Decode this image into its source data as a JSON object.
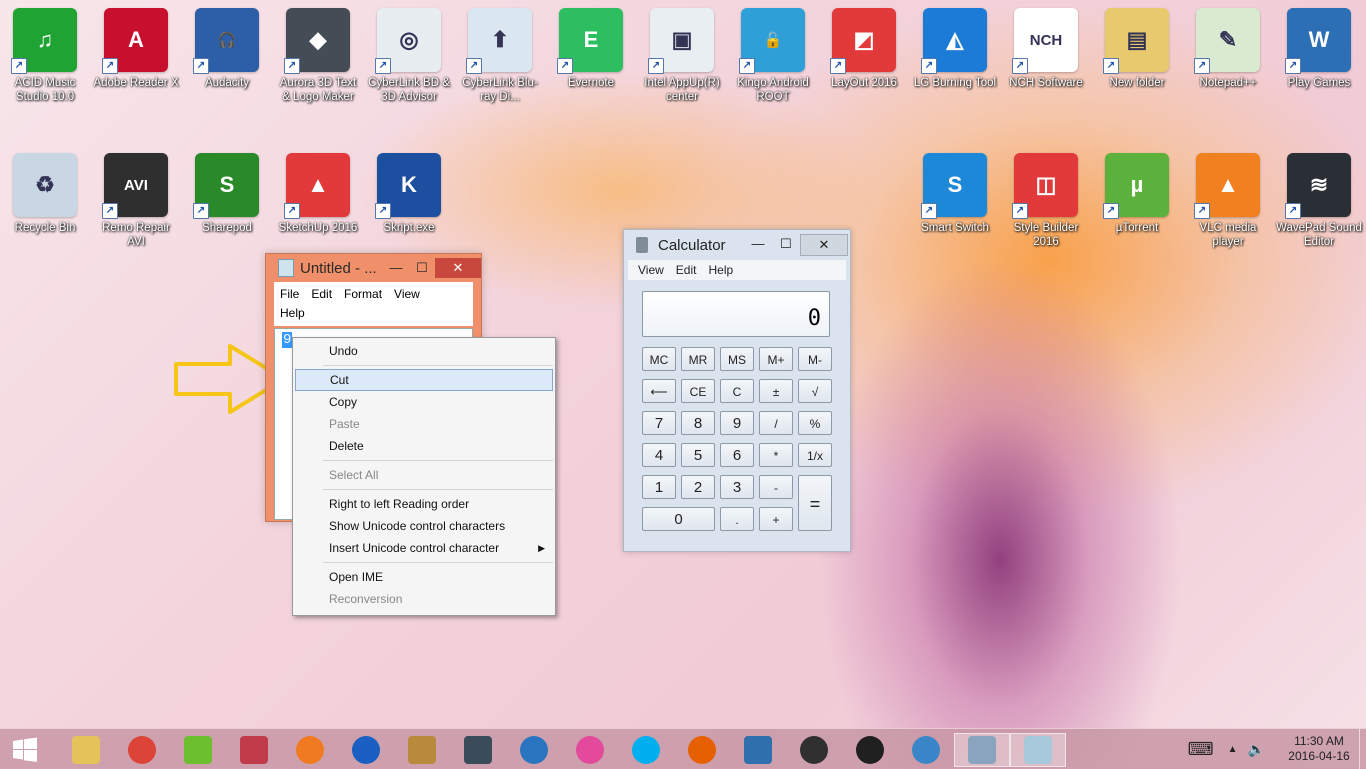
{
  "desktop": {
    "icons_row1": [
      {
        "label": "ACID Music Studio 10.0",
        "color": "#1fa333",
        "glyph": "♫"
      },
      {
        "label": "Adobe Reader X",
        "color": "#c8102e",
        "glyph": "A"
      },
      {
        "label": "Audacity",
        "color": "#2d5fa8",
        "glyph": "🎧"
      },
      {
        "label": "Aurora 3D Text & Logo Maker",
        "color": "#444c56",
        "glyph": "◆"
      },
      {
        "label": "CyberLink BD & 3D Advisor",
        "color": "#e8edf2",
        "glyph": "◎"
      },
      {
        "label": "CyberLink Blu-ray Di...",
        "color": "#dbe7f0",
        "glyph": "⬆"
      },
      {
        "label": "Evernote",
        "color": "#2dbe60",
        "glyph": "E"
      },
      {
        "label": "Intel AppUp(R) center",
        "color": "#e9eef3",
        "glyph": "▣"
      },
      {
        "label": "Kingo Android ROOT",
        "color": "#2f9fd8",
        "glyph": "🔓"
      },
      {
        "label": "LayOut 2016",
        "color": "#e23a3a",
        "glyph": "◩"
      },
      {
        "label": "LG Burning Tool",
        "color": "#1c7bd6",
        "glyph": "◭"
      },
      {
        "label": "NCH Software",
        "color": "#ffffff",
        "glyph": "NCH"
      },
      {
        "label": "New folder",
        "color": "#e9c96d",
        "glyph": "▤"
      },
      {
        "label": "Notepad++",
        "color": "#d9ead0",
        "glyph": "✎"
      },
      {
        "label": "Play Games",
        "color": "#2d6fb5",
        "glyph": "W"
      }
    ],
    "icons_row2_left": [
      {
        "label": "Recycle Bin",
        "color": "#c9d7e4",
        "glyph": "♻"
      },
      {
        "label": "Remo Repair AVI",
        "color": "#2f2f2f",
        "glyph": "AVI"
      },
      {
        "label": "Sharepod",
        "color": "#2a8a2a",
        "glyph": "S"
      },
      {
        "label": "SketchUp 2016",
        "color": "#e23a3a",
        "glyph": "▲"
      },
      {
        "label": "Skript.exe",
        "color": "#1d4fa0",
        "glyph": "K"
      }
    ],
    "icons_row2_right": [
      {
        "label": "Smart Switch",
        "color": "#1e88d8",
        "glyph": "S"
      },
      {
        "label": "Style Builder 2016",
        "color": "#e23a3a",
        "glyph": "◫"
      },
      {
        "label": "µTorrent",
        "color": "#5bb13b",
        "glyph": "µ"
      },
      {
        "label": "VLC media player",
        "color": "#f08020",
        "glyph": "▲"
      },
      {
        "label": "WavePad Sound Editor",
        "color": "#2a2f36",
        "glyph": "≋"
      }
    ]
  },
  "notepad": {
    "title": "Untitled - ...",
    "minimize": "—",
    "maximize": "☐",
    "close": "✕",
    "menu": [
      "File",
      "Edit",
      "Format",
      "View",
      "Help"
    ],
    "text": "9"
  },
  "context_menu": {
    "items": [
      {
        "label": "Undo",
        "state": "normal"
      },
      {
        "sep": true
      },
      {
        "label": "Cut",
        "state": "highlight"
      },
      {
        "label": "Copy",
        "state": "normal"
      },
      {
        "label": "Paste",
        "state": "disabled"
      },
      {
        "label": "Delete",
        "state": "normal"
      },
      {
        "sep": true
      },
      {
        "label": "Select All",
        "state": "disabled"
      },
      {
        "sep": true
      },
      {
        "label": "Right to left Reading order",
        "state": "normal"
      },
      {
        "label": "Show Unicode control characters",
        "state": "normal"
      },
      {
        "label": "Insert Unicode control character",
        "state": "normal",
        "submenu": true
      },
      {
        "sep": true
      },
      {
        "label": "Open IME",
        "state": "normal"
      },
      {
        "label": "Reconversion",
        "state": "disabled"
      }
    ]
  },
  "calculator": {
    "title": "Calculator",
    "minimize": "—",
    "maximize": "☐",
    "close": "✕",
    "menu": [
      "View",
      "Edit",
      "Help"
    ],
    "display": "0",
    "keys": [
      [
        "MC",
        "MR",
        "MS",
        "M+",
        "M-"
      ],
      [
        "⟵",
        "CE",
        "C",
        "±",
        "√"
      ],
      [
        "7",
        "8",
        "9",
        "/",
        "%"
      ],
      [
        "4",
        "5",
        "6",
        "*",
        "1/x"
      ],
      [
        "1",
        "2",
        "3",
        "-",
        "="
      ],
      [
        "0",
        ".",
        "+"
      ]
    ]
  },
  "taskbar": {
    "apps": [
      {
        "name": "file-explorer",
        "color": "#e6c25a"
      },
      {
        "name": "chrome",
        "color": "#db4437"
      },
      {
        "name": "wondershare",
        "color": "#6cbf2e"
      },
      {
        "name": "winrar",
        "color": "#c23b4b"
      },
      {
        "name": "video-player",
        "color": "#f07a20"
      },
      {
        "name": "malwarebytes",
        "color": "#1b5fc2"
      },
      {
        "name": "app-library",
        "color": "#b98a3c"
      },
      {
        "name": "video-editor",
        "color": "#3a4b5a"
      },
      {
        "name": "cyberlink",
        "color": "#2a75c0"
      },
      {
        "name": "itunes",
        "color": "#e44a9c"
      },
      {
        "name": "skype",
        "color": "#00aff0"
      },
      {
        "name": "firefox",
        "color": "#e66000"
      },
      {
        "name": "remote-desktop",
        "color": "#2f6fae"
      },
      {
        "name": "hypercam",
        "color": "#303030"
      },
      {
        "name": "media-player",
        "color": "#202020"
      },
      {
        "name": "safari",
        "color": "#3a86c8"
      },
      {
        "name": "calculator",
        "color": "#8aa4c0"
      },
      {
        "name": "notepad",
        "color": "#a8c8dc"
      }
    ],
    "time": "11:30 AM",
    "date": "2016-04-16"
  }
}
